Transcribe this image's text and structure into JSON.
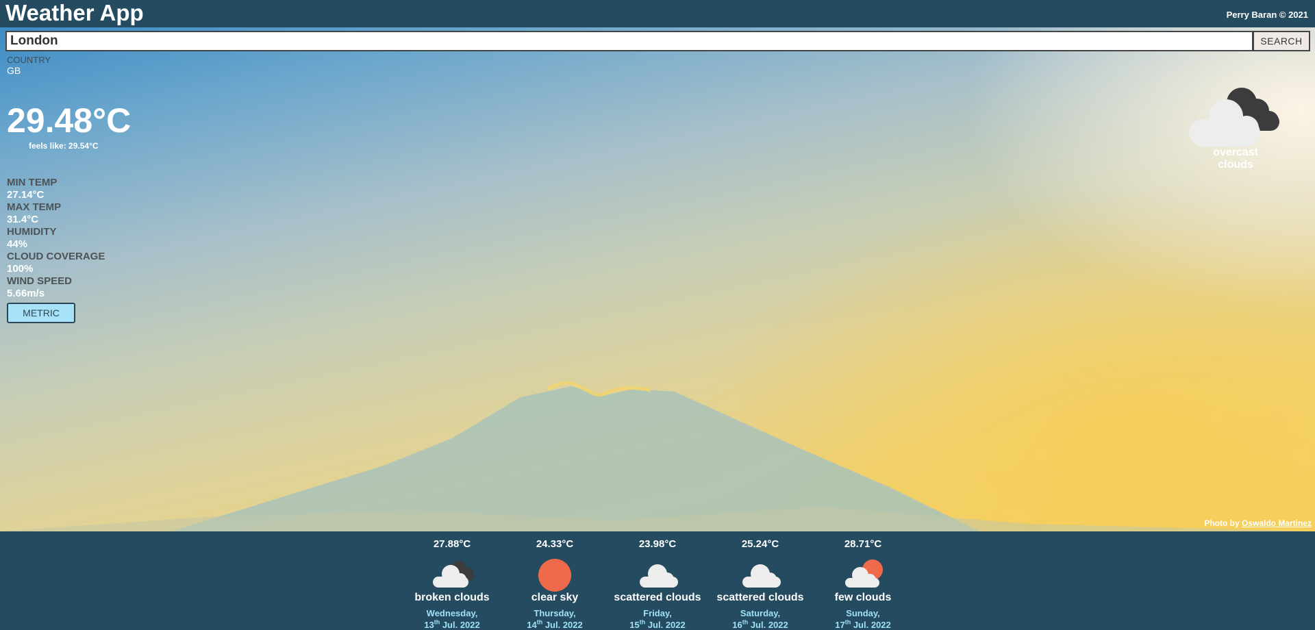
{
  "header": {
    "title": "Weather App",
    "copyright": "Perry Baran © 2021"
  },
  "search": {
    "value": "London",
    "button_label": "SEARCH"
  },
  "location": {
    "country_label": "COUNTRY",
    "country_value": "GB"
  },
  "current": {
    "temperature": "29.48°C",
    "feels_like": "feels like: 29.54°C",
    "description": "overcast clouds",
    "icon": "overcast-clouds-icon"
  },
  "stats": [
    {
      "label": "MIN TEMP",
      "value": "27.14°C"
    },
    {
      "label": "MAX TEMP",
      "value": "31.4°C"
    },
    {
      "label": "HUMIDITY",
      "value": "44%"
    },
    {
      "label": "CLOUD COVERAGE",
      "value": "100%"
    },
    {
      "label": "WIND SPEED",
      "value": "5.66m/s"
    }
  ],
  "units_button": "METRIC",
  "credit": {
    "prefix": "Photo by ",
    "author": "Oswaldo Martinez"
  },
  "forecast": [
    {
      "temp": "27.88°C",
      "desc": "broken clouds",
      "icon": "broken-clouds-icon",
      "weekday": "Wednesday,",
      "day": "13",
      "ordinal": "th",
      "month_year": " Jul. 2022"
    },
    {
      "temp": "24.33°C",
      "desc": "clear sky",
      "icon": "clear-sky-icon",
      "weekday": "Thursday,",
      "day": "14",
      "ordinal": "th",
      "month_year": " Jul. 2022"
    },
    {
      "temp": "23.98°C",
      "desc": "scattered clouds",
      "icon": "scattered-clouds-icon",
      "weekday": "Friday,",
      "day": "15",
      "ordinal": "th",
      "month_year": " Jul. 2022"
    },
    {
      "temp": "25.24°C",
      "desc": "scattered clouds",
      "icon": "scattered-clouds-icon",
      "weekday": "Saturday,",
      "day": "16",
      "ordinal": "th",
      "month_year": " Jul. 2022"
    },
    {
      "temp": "28.71°C",
      "desc": "few clouds",
      "icon": "few-clouds-icon",
      "weekday": "Sunday,",
      "day": "17",
      "ordinal": "th",
      "month_year": " Jul. 2022"
    }
  ],
  "colors": {
    "bar": "#244b5f",
    "accent": "#a8e2f8",
    "sun": "#ee6a4a",
    "date": "#9fe0f6"
  }
}
